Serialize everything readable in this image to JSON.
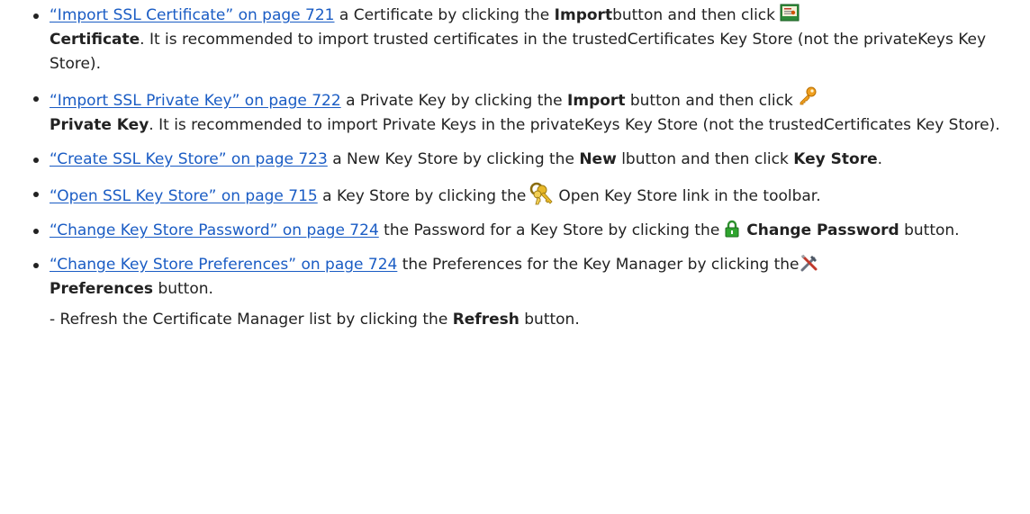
{
  "items": [
    {
      "link": "“Import SSL Certificate” on page 721",
      "t1": " a Certificate by clicking the ",
      "b1": "Import",
      "t2": "button and then click ",
      "b2": "Certificate",
      "t3": ". It is recommended to import trusted certificates in the trustedCertificates Key Store (not the privateKeys Key Store)."
    },
    {
      "link": "“Import SSL Private Key” on page 722",
      "t1": " a Private Key by clicking the ",
      "b1": "Import",
      "t2": " button and then click ",
      "b2": "Private Key",
      "t3": ". It is recommended to import Private Keys in the privateKeys Key Store (not the trustedCertificates Key Store)."
    },
    {
      "link": "“Create SSL Key Store” on page 723",
      "t1": " a New Key Store by clicking the ",
      "b1": "New",
      "t2": " lbutton and then click ",
      "b2": "Key Store",
      "t3": "."
    },
    {
      "link": "“Open SSL Key Store” on page 715",
      "t1": " a Key Store by clicking the",
      "t2": "Open Key Store link in the toolbar."
    },
    {
      "link": "“Change Key Store Password” on page 724",
      "t1": " the Password for a Key Store by clicking the",
      "b1": "Change Password",
      "t2": " button."
    },
    {
      "link": "“Change Key Store Preferences” on page 724",
      "t1": " the Preferences for the Key Manager by clicking the",
      "b1": "Preferences",
      "t2": " button."
    }
  ],
  "sub": {
    "t1": "- Refresh the Certificate Manager list by clicking the ",
    "b1": "Refresh",
    "t2": " button."
  },
  "icons": {
    "certificate": "certificate-icon",
    "private_key": "key-icon",
    "key_store": "keyring-icon",
    "password": "lock-icon",
    "preferences": "tools-icon"
  },
  "colors": {
    "link": "#1a5cc4",
    "text": "#222222"
  }
}
